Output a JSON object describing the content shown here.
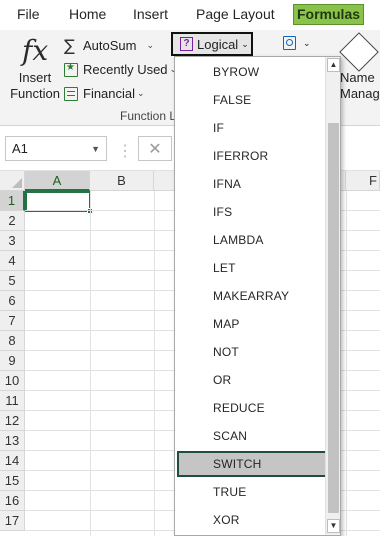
{
  "menubar": {
    "items": [
      {
        "label": "File",
        "active": false
      },
      {
        "label": "Home",
        "active": false
      },
      {
        "label": "Insert",
        "active": false
      },
      {
        "label": "Page Layout",
        "active": false
      },
      {
        "label": "Formulas",
        "active": true
      }
    ]
  },
  "ribbon": {
    "insert_function": {
      "glyph": "fx",
      "label_line1": "Insert",
      "label_line2": "Function"
    },
    "autosum": {
      "label": "AutoSum",
      "chevron": "⌄"
    },
    "recently_used": {
      "label": "Recently Used",
      "chevron": "⌄"
    },
    "financial": {
      "label": "Financial",
      "chevron": "⌄"
    },
    "logical": {
      "label": "Logical",
      "chevron": "⌄"
    },
    "lookup_chevron": "⌄",
    "name_manager": {
      "line1": "Name",
      "line2": "Manager"
    },
    "group_label": "Function Library"
  },
  "formula_bar": {
    "name_box": "A1",
    "cancel_glyph": "✕"
  },
  "grid": {
    "columns": [
      "A",
      "B",
      "F"
    ],
    "selected_column": "A",
    "rows": [
      "1",
      "2",
      "3",
      "4",
      "5",
      "6",
      "7",
      "8",
      "9",
      "10",
      "11",
      "12",
      "13",
      "14",
      "15",
      "16",
      "17"
    ],
    "selected_row": "1",
    "active_cell": "A1"
  },
  "dropdown": {
    "items": [
      "BYROW",
      "FALSE",
      "IF",
      "IFERROR",
      "IFNA",
      "IFS",
      "LAMBDA",
      "LET",
      "MAKEARRAY",
      "MAP",
      "NOT",
      "OR",
      "REDUCE",
      "SCAN",
      "SWITCH",
      "TRUE",
      "XOR"
    ],
    "highlighted": "SWITCH",
    "scroll_up_glyph": "▲",
    "scroll_down_glyph": "▼"
  },
  "colors": {
    "accent_green": "#217346",
    "formulas_tab_bg": "#8bc34a",
    "highlight_border": "#1f4e3d"
  }
}
